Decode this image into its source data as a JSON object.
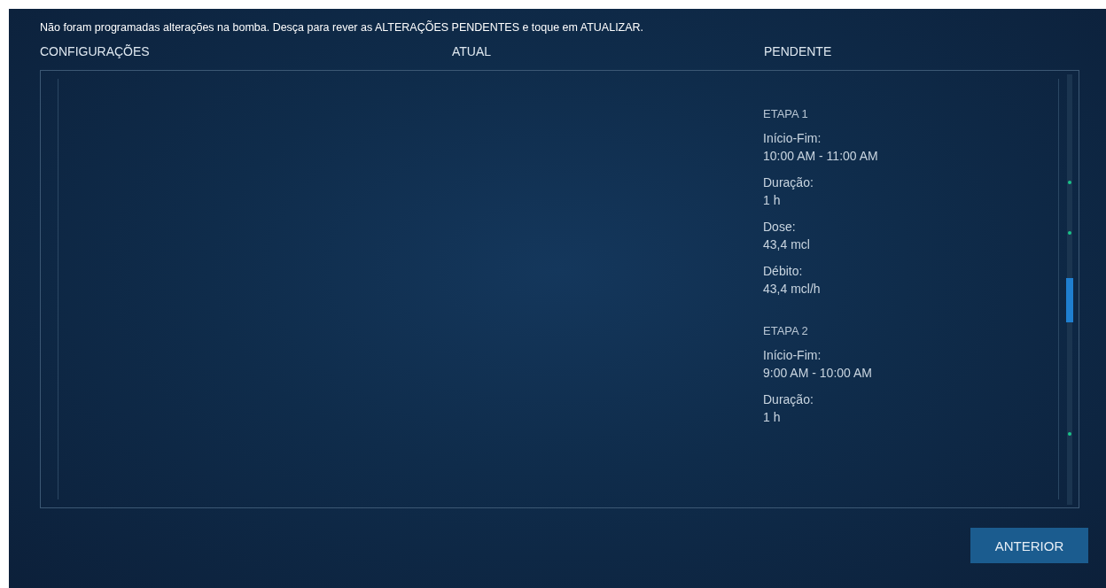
{
  "message": "Não foram programadas alterações na bomba. Desça para rever as ALTERAÇÕES PENDENTES e toque em ATUALIZAR.",
  "columns": [
    "CONFIGURAÇÕES",
    "ATUAL",
    "PENDENTE"
  ],
  "stages": [
    {
      "title": "ETAPA 1",
      "fields": [
        {
          "label": "Início-Fim:",
          "value": "10:00 AM - 11:00 AM"
        },
        {
          "label": "Duração:",
          "value": "1 h"
        },
        {
          "label": "Dose:",
          "value": "43,4 mcl"
        },
        {
          "label": "Débito:",
          "value": "43,4 mcl/h"
        }
      ]
    },
    {
      "title": "ETAPA 2",
      "fields": [
        {
          "label": "Início-Fim:",
          "value": "9:00 AM - 10:00 AM"
        },
        {
          "label": "Duração:",
          "value": "1 h"
        }
      ]
    }
  ],
  "button": "ANTERIOR"
}
